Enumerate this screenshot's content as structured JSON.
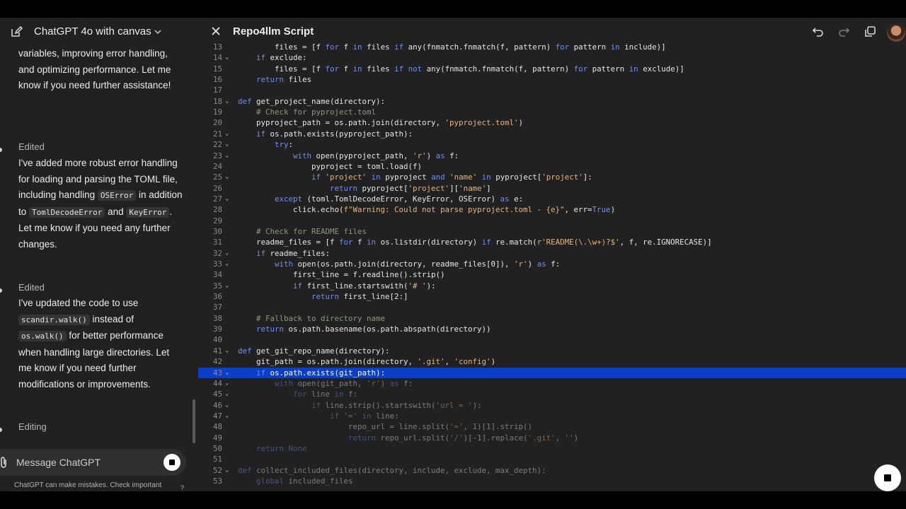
{
  "chat": {
    "model_title": "ChatGPT 4o with canvas",
    "messages": [
      {
        "text": "variables, improving error handling, and optimizing performance. Let me know if you need further assistance!"
      },
      {
        "tag": "Edited",
        "parts": [
          "I've added more robust error handling for loading and parsing the TOML file, including handling ",
          "OSError",
          " in addition to ",
          "TomlDecodeError",
          " and ",
          "KeyError",
          ". Let me know if you need any further changes."
        ]
      },
      {
        "tag": "Edited",
        "parts": [
          "I've updated the code to use ",
          "scandir.walk()",
          " instead of ",
          "os.walk()",
          " for better performance when handling large directories. Let me know if you need further modifications or improvements."
        ]
      },
      {
        "tag": "Editing"
      }
    ],
    "composer_placeholder": "Message ChatGPT",
    "disclaimer": "ChatGPT can make mistakes. Check important",
    "help": "?"
  },
  "canvas": {
    "title": "Repo4llm Script",
    "highlighted_line": 43,
    "icons": [
      "close-icon",
      "undo-icon",
      "redo-icon",
      "copy-icon",
      "avatar"
    ],
    "lines": [
      {
        "n": 13,
        "fold": false,
        "code": "        files = [f for f in files if any(fnmatch.fnmatch(f, pattern) for pattern in include)]"
      },
      {
        "n": 14,
        "fold": true,
        "code": "    if exclude:"
      },
      {
        "n": 15,
        "fold": false,
        "code": "        files = [f for f in files if not any(fnmatch.fnmatch(f, pattern) for pattern in exclude)]"
      },
      {
        "n": 16,
        "fold": false,
        "code": "    return files"
      },
      {
        "n": 17,
        "fold": false,
        "code": ""
      },
      {
        "n": 18,
        "fold": true,
        "code": "def get_project_name(directory):"
      },
      {
        "n": 19,
        "fold": false,
        "code": "    # Check for pyproject.toml"
      },
      {
        "n": 20,
        "fold": false,
        "code": "    pyproject_path = os.path.join(directory, 'pyproject.toml')"
      },
      {
        "n": 21,
        "fold": true,
        "code": "    if os.path.exists(pyproject_path):"
      },
      {
        "n": 22,
        "fold": true,
        "code": "        try:"
      },
      {
        "n": 23,
        "fold": true,
        "code": "            with open(pyproject_path, 'r') as f:"
      },
      {
        "n": 24,
        "fold": false,
        "code": "                pyproject = toml.load(f)"
      },
      {
        "n": 25,
        "fold": true,
        "code": "                if 'project' in pyproject and 'name' in pyproject['project']:"
      },
      {
        "n": 26,
        "fold": false,
        "code": "                    return pyproject['project']['name']"
      },
      {
        "n": 27,
        "fold": true,
        "code": "        except (toml.TomlDecodeError, KeyError, OSError) as e:"
      },
      {
        "n": 28,
        "fold": false,
        "code": "            click.echo(f\"Warning: Could not parse pyproject.toml - {e}\", err=True)"
      },
      {
        "n": 29,
        "fold": false,
        "code": ""
      },
      {
        "n": 30,
        "fold": false,
        "code": "    # Check for README files"
      },
      {
        "n": 31,
        "fold": false,
        "code": "    readme_files = [f for f in os.listdir(directory) if re.match(r'README(\\.\\w+)?$', f, re.IGNORECASE)]"
      },
      {
        "n": 32,
        "fold": true,
        "code": "    if readme_files:"
      },
      {
        "n": 33,
        "fold": true,
        "code": "        with open(os.path.join(directory, readme_files[0]), 'r') as f:"
      },
      {
        "n": 34,
        "fold": false,
        "code": "            first_line = f.readline().strip()"
      },
      {
        "n": 35,
        "fold": true,
        "code": "            if first_line.startswith('# '):"
      },
      {
        "n": 36,
        "fold": false,
        "code": "                return first_line[2:]"
      },
      {
        "n": 37,
        "fold": false,
        "code": ""
      },
      {
        "n": 38,
        "fold": false,
        "code": "    # Fallback to directory name"
      },
      {
        "n": 39,
        "fold": false,
        "code": "    return os.path.basename(os.path.abspath(directory))"
      },
      {
        "n": 40,
        "fold": false,
        "code": ""
      },
      {
        "n": 41,
        "fold": true,
        "code": "def get_git_repo_name(directory):"
      },
      {
        "n": 42,
        "fold": false,
        "code": "    git_path = os.path.join(directory, '.git', 'config')"
      },
      {
        "n": 43,
        "fold": true,
        "code": "    if os.path.exists(git_path):"
      },
      {
        "n": 44,
        "fold": true,
        "code": "        with open(git_path, 'r') as f:"
      },
      {
        "n": 45,
        "fold": true,
        "code": "            for line in f:"
      },
      {
        "n": 46,
        "fold": true,
        "code": "                if line.strip().startswith('url = '):"
      },
      {
        "n": 47,
        "fold": true,
        "code": "                    if '=' in line:"
      },
      {
        "n": 48,
        "fold": false,
        "code": "                        repo_url = line.split('=', 1)[1].strip()"
      },
      {
        "n": 49,
        "fold": false,
        "code": "                        return repo_url.split('/')[-1].replace('.git', '')"
      },
      {
        "n": 50,
        "fold": false,
        "code": "    return None"
      },
      {
        "n": 51,
        "fold": false,
        "code": ""
      },
      {
        "n": 52,
        "fold": true,
        "code": "def collect_included_files(directory, include, exclude, max_depth):"
      },
      {
        "n": 53,
        "fold": false,
        "code": "    global included_files"
      }
    ]
  },
  "colors": {
    "background": "#212121",
    "highlight": "#0b3fc7",
    "keyword": "#6f8ff3",
    "string": "#e4b67a"
  }
}
